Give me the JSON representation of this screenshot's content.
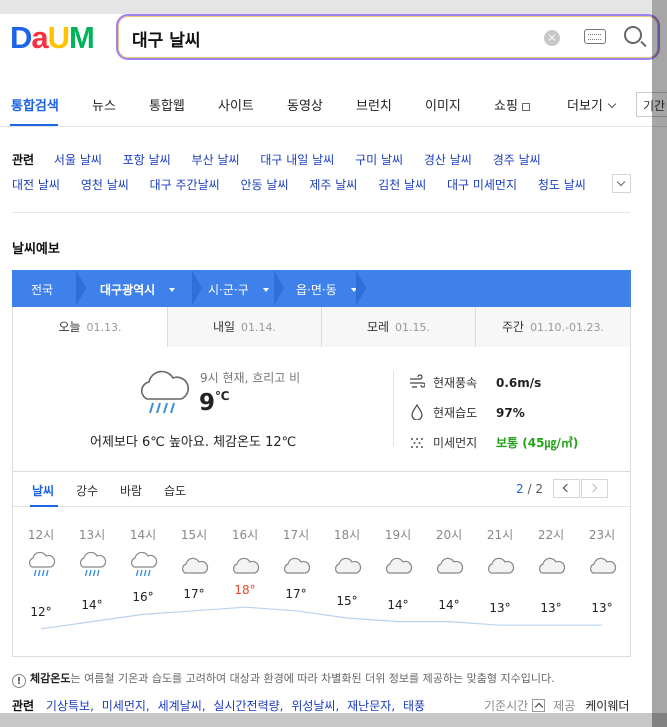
{
  "logo": {
    "parts": [
      "D",
      "a",
      "U",
      "M"
    ]
  },
  "search": {
    "query": "대구 날씨",
    "clear": "×"
  },
  "tabs": [
    {
      "label": "통합검색"
    },
    {
      "label": "뉴스"
    },
    {
      "label": "통합웹"
    },
    {
      "label": "사이트"
    },
    {
      "label": "동영상"
    },
    {
      "label": "브런치"
    },
    {
      "label": "이미지"
    },
    {
      "label": "쇼핑"
    },
    {
      "label": "더보기"
    },
    {
      "label": "기간"
    }
  ],
  "related": {
    "label": "관련",
    "row1": [
      "서울 날씨",
      "포항 날씨",
      "부산 날씨",
      "대구 내일 날씨",
      "구미 날씨",
      "경산 날씨",
      "경주 날씨"
    ],
    "row2": [
      "대전 날씨",
      "영천 날씨",
      "대구 주간날씨",
      "안동 날씨",
      "제주 날씨",
      "김천 날씨",
      "대구 미세먼지",
      "청도 날씨"
    ]
  },
  "section_title": "날씨예보",
  "regions": [
    "전국",
    "대구광역시",
    "시·군·구",
    "읍·면·동"
  ],
  "days": [
    {
      "label": "오늘",
      "date": "01.13."
    },
    {
      "label": "내일",
      "date": "01.14."
    },
    {
      "label": "모레",
      "date": "01.15."
    },
    {
      "label": "주간",
      "date": "01.10.-01.23."
    }
  ],
  "now": {
    "desc": "9시 현재, 흐리고 비",
    "temp": "9",
    "unit": "℃",
    "compare": "어제보다 6℃ 높아요.  체감온도 12℃",
    "wind_label": "현재풍속",
    "wind": "0.6m/s",
    "humidity_label": "현재습도",
    "humidity": "97%",
    "dust_label": "미세먼지",
    "dust": "보통 (45㎍/㎥)",
    "dust_color": "#26a21a"
  },
  "subtabs": [
    "날씨",
    "강수",
    "바람",
    "습도"
  ],
  "pager": {
    "current": "2",
    "total": "/ 2"
  },
  "hourly": {
    "hours": [
      "12시",
      "13시",
      "14시",
      "15시",
      "16시",
      "17시",
      "18시",
      "19시",
      "20시",
      "21시",
      "22시",
      "23시"
    ],
    "icons": [
      "rain",
      "rain",
      "rain",
      "cloud",
      "cloud",
      "cloud",
      "cloud",
      "cloud",
      "cloud",
      "cloud",
      "cloud",
      "cloud"
    ],
    "temps": [
      12,
      14,
      16,
      17,
      18,
      17,
      15,
      14,
      14,
      13,
      13,
      13
    ],
    "temp_labels": [
      "12°",
      "14°",
      "16°",
      "17°",
      "18°",
      "17°",
      "15°",
      "14°",
      "14°",
      "13°",
      "13°",
      "13°"
    ],
    "high_index": 4
  },
  "notice": {
    "bang": "!",
    "term": "체감온도",
    "text": "는 여름철 기온과 습도를 고려하여 대상과 환경에 따라 차별화된 더위 정보를 제공하는 맞춤형 지수입니다."
  },
  "bottom": {
    "label": "관련",
    "links": [
      "기상특보",
      "미세먼지",
      "세계날씨",
      "실시간전력량",
      "위성날씨",
      "재난문자",
      "태풍"
    ],
    "ref_time": "기준시간",
    "provider_label": "제공",
    "provider": "케이웨더"
  },
  "colors": {
    "accent": "#1e64e6",
    "region_bar": "#3f81ea",
    "high_temp": "#e8472c"
  }
}
